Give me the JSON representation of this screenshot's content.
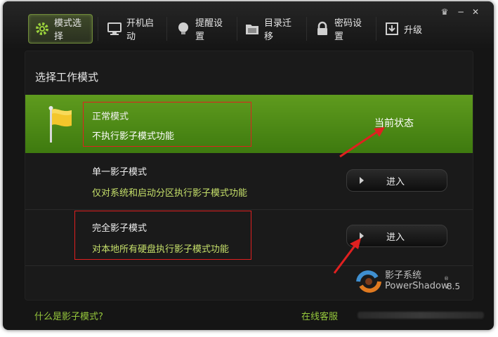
{
  "tabs": [
    {
      "label": "模式选择",
      "icon": "gear-icon"
    },
    {
      "label": "开机启动",
      "icon": "monitor-icon"
    },
    {
      "label": "提醒设置",
      "icon": "bulb-icon"
    },
    {
      "label": "目录迁移",
      "icon": "folder-icon"
    },
    {
      "label": "密码设置",
      "icon": "lock-icon"
    },
    {
      "label": "升级",
      "icon": "download-icon"
    }
  ],
  "window_controls": {
    "skin": "♛",
    "minimize": "−",
    "close": "✕"
  },
  "panel": {
    "title": "选择工作模式",
    "modes": [
      {
        "name": "正常模式",
        "desc": "不执行影子模式功能",
        "status": "当前状态"
      },
      {
        "name": "单一影子模式",
        "desc": "仅对系统和启动分区执行影子模式功能",
        "button": "进入"
      },
      {
        "name": "完全影子模式",
        "desc": "对本地所有硬盘执行影子模式功能",
        "button": "进入"
      }
    ]
  },
  "brand": {
    "name": "影子系统",
    "name_en": "PowerShadow",
    "reg": "®",
    "version": "8.5"
  },
  "footer": {
    "help_link": "什么是影子模式?",
    "service_link": "在线客服"
  },
  "colors": {
    "accent_green": "#5f9b1e",
    "link_green": "#96c83c",
    "desc_green": "#c6e06a",
    "annotation_red": "#e02020"
  }
}
